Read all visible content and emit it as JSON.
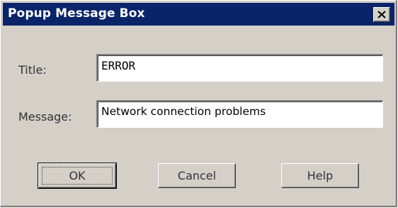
{
  "window": {
    "title": "Popup Message Box",
    "close_icon": "close-x-icon"
  },
  "form": {
    "title_label": "Title:",
    "title_value": "ERROR",
    "message_label": "Message:",
    "message_value": "Network connection problems"
  },
  "buttons": {
    "ok": "OK",
    "cancel": "Cancel",
    "help": "Help"
  },
  "colors": {
    "titlebar": "#0a246a",
    "face": "#d4d0c8"
  }
}
